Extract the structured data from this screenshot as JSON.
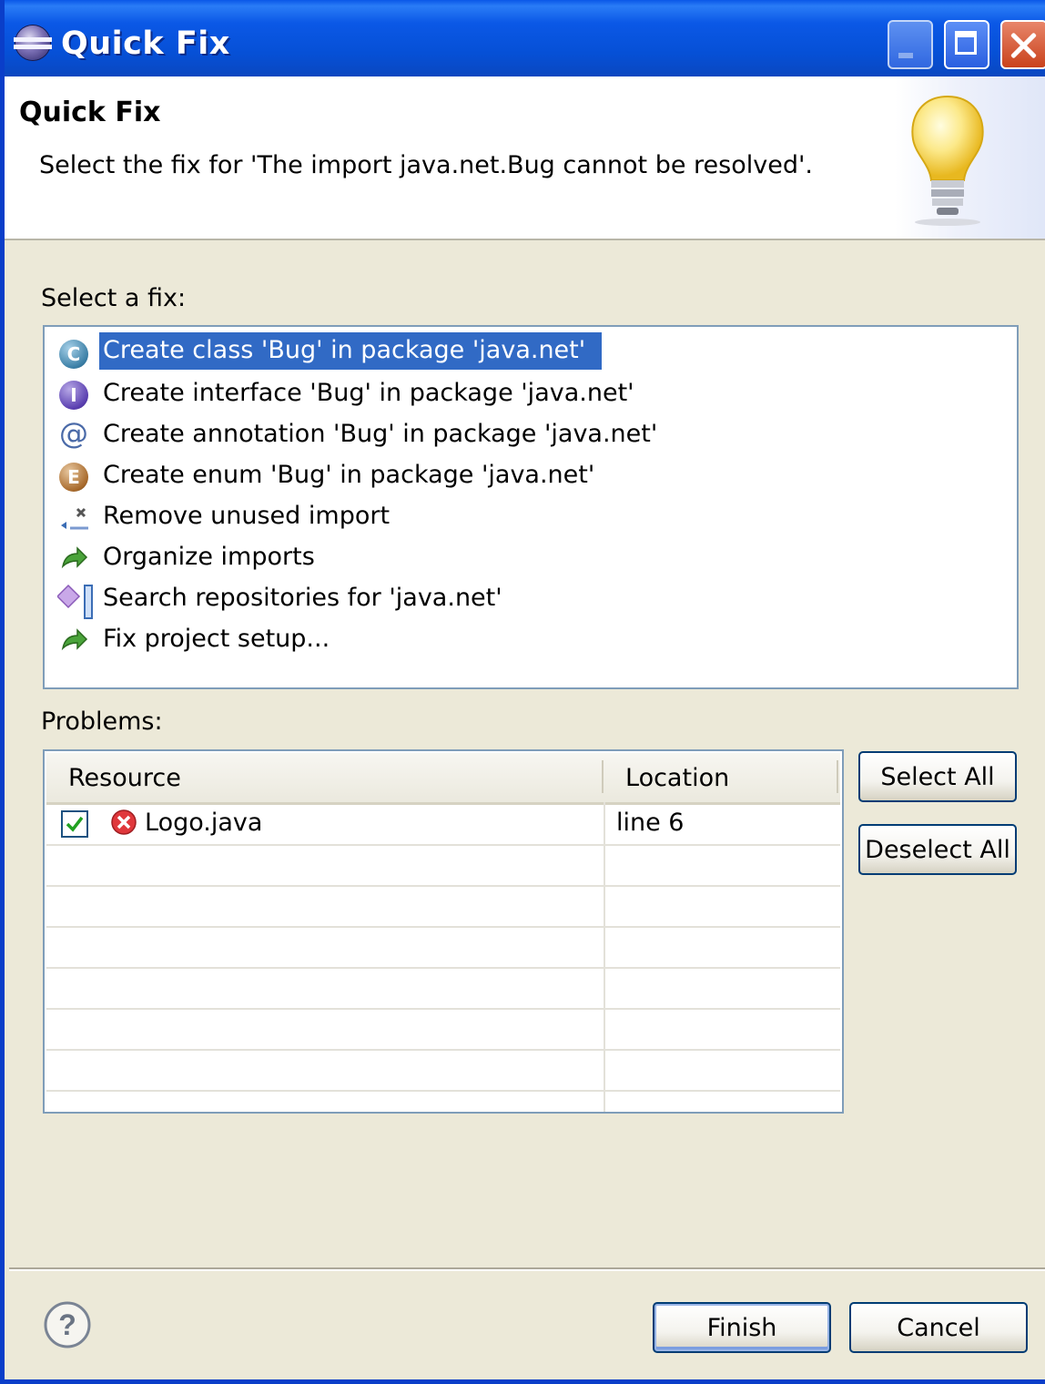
{
  "window": {
    "title": "Quick Fix"
  },
  "banner": {
    "title": "Quick Fix",
    "message": "Select the fix for 'The import java.net.Bug cannot be resolved'."
  },
  "fixes": {
    "label": "Select a fix:",
    "items": [
      {
        "label": "Create class 'Bug' in package 'java.net'",
        "icon": "class-icon",
        "selected": true
      },
      {
        "label": "Create interface 'Bug' in package 'java.net'",
        "icon": "interface-icon",
        "selected": false
      },
      {
        "label": "Create annotation 'Bug' in package 'java.net'",
        "icon": "annotation-icon",
        "selected": false
      },
      {
        "label": "Create enum 'Bug' in package 'java.net'",
        "icon": "enum-icon",
        "selected": false
      },
      {
        "label": "Remove unused import",
        "icon": "remove-import-icon",
        "selected": false
      },
      {
        "label": "Organize imports",
        "icon": "organize-icon",
        "selected": false
      },
      {
        "label": "Search repositories for 'java.net'",
        "icon": "search-repo-icon",
        "selected": false
      },
      {
        "label": "Fix project setup...",
        "icon": "project-setup-icon",
        "selected": false
      }
    ]
  },
  "problems": {
    "label": "Problems:",
    "columns": [
      "Resource",
      "Location"
    ],
    "rows": [
      {
        "checked": true,
        "resource": "Logo.java",
        "location": "line 6"
      }
    ]
  },
  "side_buttons": {
    "select_all": "Select All",
    "deselect_all": "Deselect All"
  },
  "footer": {
    "finish": "Finish",
    "cancel": "Cancel"
  },
  "colors": {
    "titlebar": "#0a57e8",
    "selection": "#316ac5",
    "dialog_bg": "#ece9d8"
  }
}
